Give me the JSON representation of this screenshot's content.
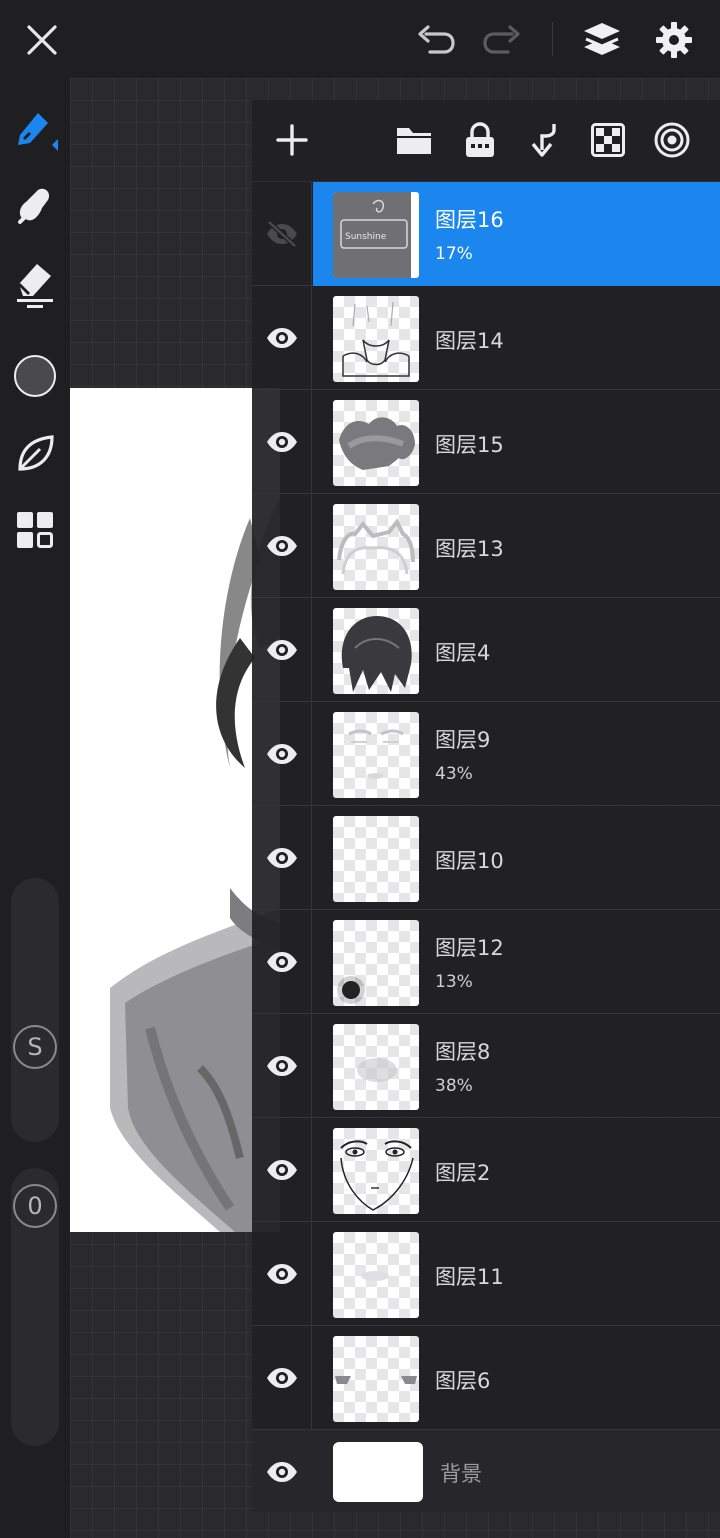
{
  "topbar": {
    "close_icon": "close-icon",
    "undo_icon": "undo-icon",
    "redo_icon": "redo-icon",
    "layers_icon": "layers-icon",
    "settings_icon": "gear-icon"
  },
  "left_toolbar": {
    "tools": [
      "pen-icon",
      "smudge-icon",
      "eraser-icon",
      "color-icon",
      "leaf-icon",
      "grid-icon"
    ],
    "active_color": "#4a4a4e",
    "size_label": "S",
    "opacity_label": "0"
  },
  "layers_panel": {
    "toolbar": [
      "add-icon",
      "folder-icon",
      "lock-icon",
      "merge-down-icon",
      "transparency-icon",
      "target-icon"
    ],
    "accent_color": "#1b86ee",
    "layers": [
      {
        "name": "图层16",
        "opacity": "17%",
        "visible": false,
        "selected": true
      },
      {
        "name": "图层14",
        "opacity": "",
        "visible": true,
        "selected": false
      },
      {
        "name": "图层15",
        "opacity": "",
        "visible": true,
        "selected": false
      },
      {
        "name": "图层13",
        "opacity": "",
        "visible": true,
        "selected": false
      },
      {
        "name": "图层4",
        "opacity": "",
        "visible": true,
        "selected": false
      },
      {
        "name": "图层9",
        "opacity": "43%",
        "visible": true,
        "selected": false
      },
      {
        "name": "图层10",
        "opacity": "",
        "visible": true,
        "selected": false
      },
      {
        "name": "图层12",
        "opacity": "13%",
        "visible": true,
        "selected": false
      },
      {
        "name": "图层8",
        "opacity": "38%",
        "visible": true,
        "selected": false
      },
      {
        "name": "图层2",
        "opacity": "",
        "visible": true,
        "selected": false
      },
      {
        "name": "图层11",
        "opacity": "",
        "visible": true,
        "selected": false
      },
      {
        "name": "图层6",
        "opacity": "",
        "visible": true,
        "selected": false
      }
    ],
    "background_layer": {
      "name": "背景",
      "visible": true
    }
  }
}
